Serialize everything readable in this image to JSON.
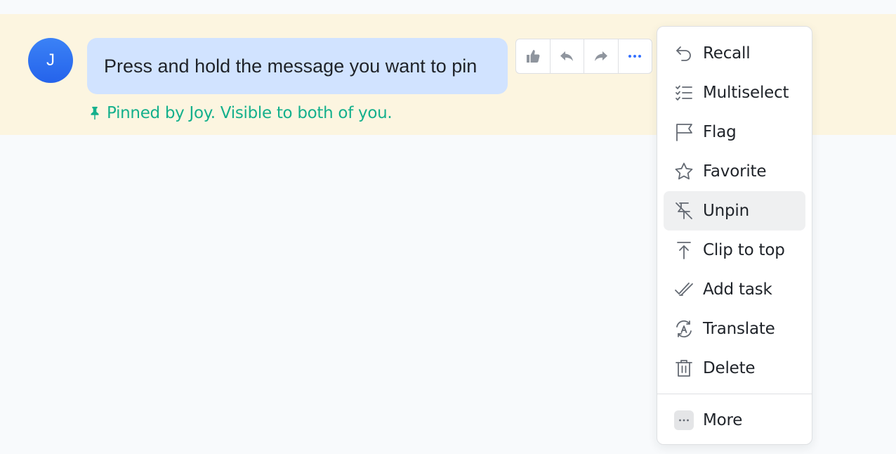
{
  "message": {
    "avatar_initial": "J",
    "text": "Press and hold the message you want to pin",
    "pin_note": "Pinned by Joy. Visible to both of you."
  },
  "actions": [
    {
      "icon": "thumbs-up-icon"
    },
    {
      "icon": "reply-icon"
    },
    {
      "icon": "forward-icon"
    },
    {
      "icon": "more-horizontal-icon"
    }
  ],
  "menu": {
    "items": [
      {
        "label": "Recall",
        "icon": "undo-icon"
      },
      {
        "label": "Multiselect",
        "icon": "checklist-icon"
      },
      {
        "label": "Flag",
        "icon": "flag-icon"
      },
      {
        "label": "Favorite",
        "icon": "star-icon"
      },
      {
        "label": "Unpin",
        "icon": "unpin-icon",
        "active": true
      },
      {
        "label": "Clip to top",
        "icon": "arrow-to-top-icon"
      },
      {
        "label": "Add task",
        "icon": "add-task-icon"
      },
      {
        "label": "Translate",
        "icon": "translate-icon"
      },
      {
        "label": "Delete",
        "icon": "trash-icon"
      }
    ],
    "more_label": "More"
  },
  "colors": {
    "pinned_background": "#fcf5e0",
    "bubble": "#d1e3ff",
    "pin_note": "#14b08c",
    "accent": "#3370ff",
    "icon": "#646a73"
  }
}
